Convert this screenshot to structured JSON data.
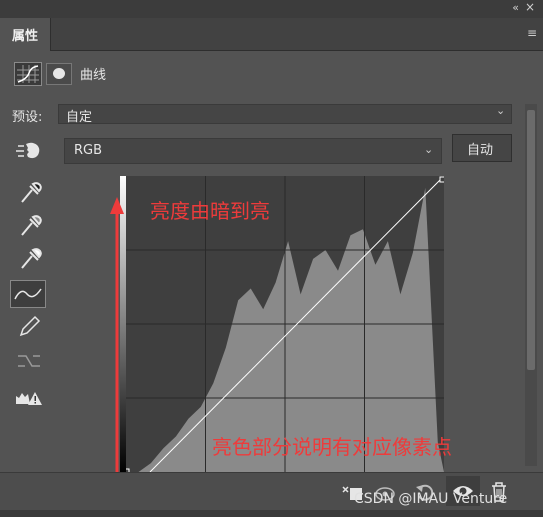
{
  "panel": {
    "collapse_glyph": "«",
    "close_glyph": "×",
    "tab_label": "属性",
    "menu_glyph": "≡"
  },
  "header": {
    "title": "曲线",
    "icons": [
      "curves-grid-icon",
      "mask-icon"
    ]
  },
  "preset": {
    "label": "预设:",
    "value": "自定"
  },
  "channel": {
    "value": "RGB",
    "auto_label": "自动"
  },
  "tools": [
    "hand-target-icon",
    "black-point-eyedropper-icon",
    "gray-point-eyedropper-icon",
    "white-point-eyedropper-icon",
    "curve-edit-icon",
    "pencil-icon",
    "smooth-icon",
    "clipping-warning-icon"
  ],
  "annotations": {
    "vertical": "亮度由暗到亮",
    "horizontal": "亮色部分说明有对应像素点"
  },
  "bottom_icons": [
    "clip-to-layer-icon",
    "view-previous-icon",
    "reset-icon",
    "visibility-eye-icon",
    "delete-icon"
  ],
  "watermark": "CSDN @IMAU Venture",
  "colors": {
    "panel_bg": "#535353",
    "graph_bg": "#3f3f3f",
    "histogram": "#8a8a8a",
    "annotation": "#ee3b3b"
  },
  "chart_data": {
    "type": "area",
    "x": [
      0,
      10,
      20,
      30,
      40,
      50,
      60,
      70,
      80,
      90,
      100,
      110,
      120,
      130,
      140,
      150,
      160,
      170,
      180,
      190,
      200,
      210,
      220,
      230,
      240,
      250,
      255
    ],
    "values": [
      0,
      0,
      3,
      8,
      12,
      18,
      22,
      30,
      42,
      58,
      62,
      55,
      64,
      78,
      60,
      72,
      75,
      68,
      80,
      82,
      70,
      78,
      60,
      74,
      96,
      10,
      0
    ],
    "xlim": [
      0,
      255
    ],
    "ylim": [
      0,
      100
    ],
    "curve": [
      [
        0,
        0
      ],
      [
        255,
        255
      ]
    ]
  }
}
